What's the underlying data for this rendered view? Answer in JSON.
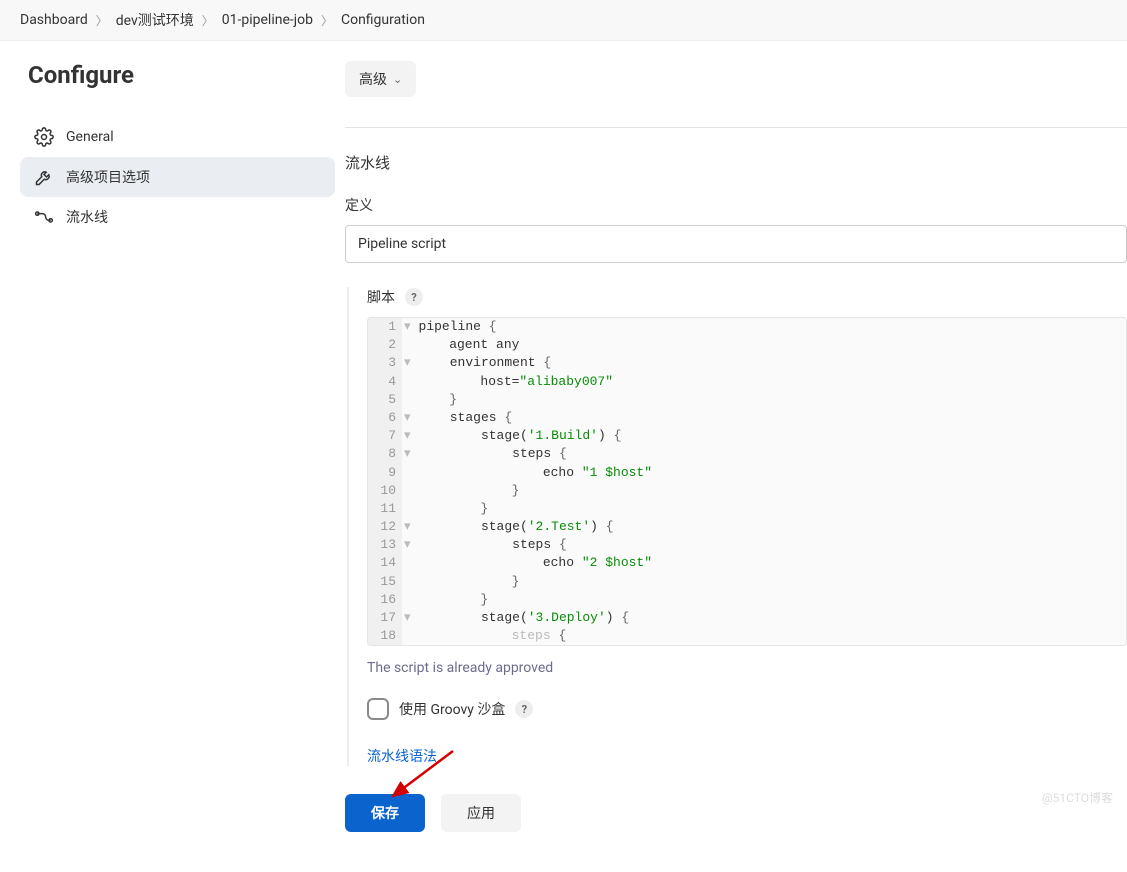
{
  "breadcrumb": [
    "Dashboard",
    "dev测试环境",
    "01-pipeline-job",
    "Configuration"
  ],
  "sidebar": {
    "title": "Configure",
    "items": [
      {
        "label": "General"
      },
      {
        "label": "高级项目选项"
      },
      {
        "label": "流水线"
      }
    ]
  },
  "main": {
    "advanced_button": "高级",
    "pipeline_heading": "流水线",
    "definition_label": "定义",
    "definition_value": "Pipeline script",
    "script_label": "脚本",
    "editor": {
      "lines": [
        {
          "n": 1,
          "fold": true,
          "html": "pipeline <span class='punc'>{</span>"
        },
        {
          "n": 2,
          "fold": false,
          "html": "    agent any"
        },
        {
          "n": 3,
          "fold": true,
          "html": "    environment <span class='punc'>{</span>"
        },
        {
          "n": 4,
          "fold": false,
          "html": "        host=<span class='str'>\"alibaby007\"</span>"
        },
        {
          "n": 5,
          "fold": false,
          "html": "    <span class='punc'>}</span>"
        },
        {
          "n": 6,
          "fold": true,
          "html": "    stages <span class='punc'>{</span>"
        },
        {
          "n": 7,
          "fold": true,
          "html": "        stage(<span class='str'>'1.Build'</span>) <span class='punc'>{</span>"
        },
        {
          "n": 8,
          "fold": true,
          "html": "            steps <span class='punc'>{</span>"
        },
        {
          "n": 9,
          "fold": false,
          "html": "                echo <span class='str'>\"1 $host\"</span>"
        },
        {
          "n": 10,
          "fold": false,
          "html": "            <span class='punc'>}</span>"
        },
        {
          "n": 11,
          "fold": false,
          "html": "        <span class='punc'>}</span>"
        },
        {
          "n": 12,
          "fold": true,
          "html": "        stage(<span class='str'>'2.Test'</span>) <span class='punc'>{</span>"
        },
        {
          "n": 13,
          "fold": true,
          "html": "            steps <span class='punc'>{</span>"
        },
        {
          "n": 14,
          "fold": false,
          "html": "                echo <span class='str'>\"2 $host\"</span>"
        },
        {
          "n": 15,
          "fold": false,
          "html": "            <span class='punc'>}</span>"
        },
        {
          "n": 16,
          "fold": false,
          "html": "        <span class='punc'>}</span>"
        },
        {
          "n": 17,
          "fold": true,
          "html": "        stage(<span class='str'>'3.Deploy'</span>) <span class='punc'>{</span>"
        },
        {
          "n": 18,
          "fold": false,
          "html": "            steps <span class='punc'>{</span>",
          "dim": true
        }
      ]
    },
    "approved_text": "The script is already approved",
    "sandbox_label": "使用 Groovy 沙盒",
    "syntax_link": "流水线语法",
    "save_button": "保存",
    "apply_button": "应用"
  },
  "watermark": "@51CTO博客"
}
